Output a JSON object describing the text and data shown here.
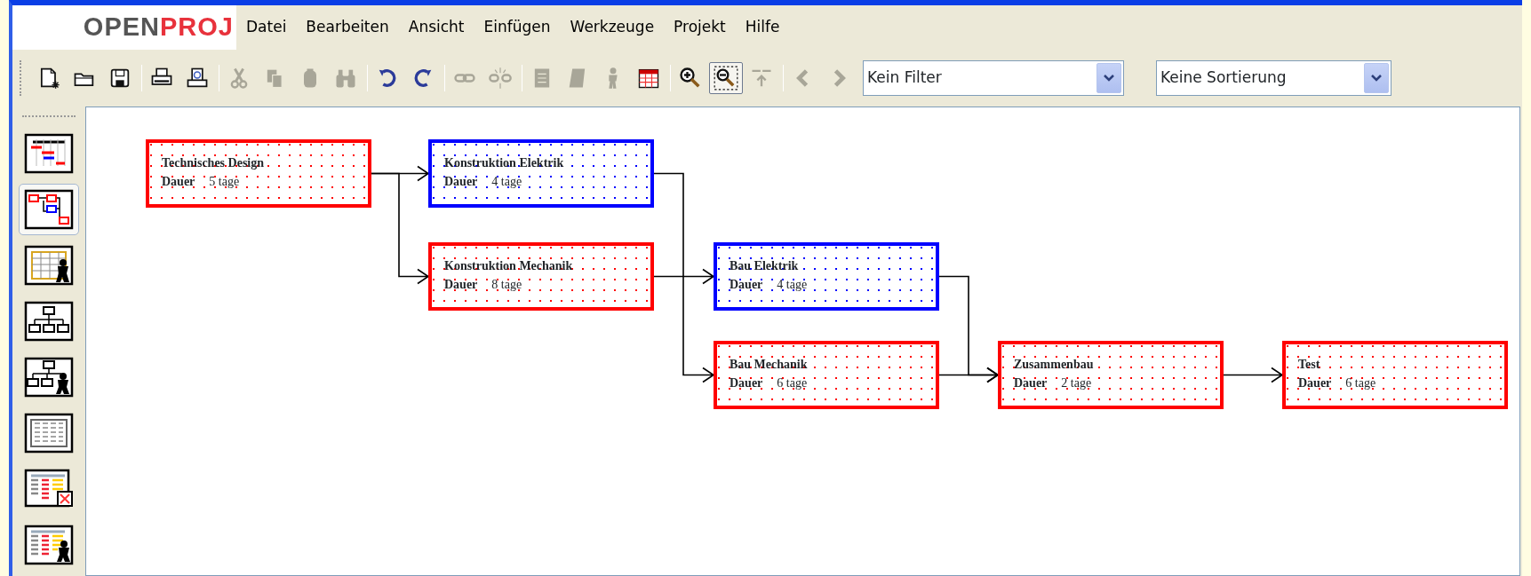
{
  "logo": {
    "text_1": "OPEN",
    "text_2": "PROJ"
  },
  "menu": [
    "Datei",
    "Bearbeiten",
    "Ansicht",
    "Einfügen",
    "Werkzeuge",
    "Projekt",
    "Hilfe"
  ],
  "toolbar": [
    {
      "disabled": false,
      "selected": false
    },
    {
      "disabled": false,
      "selected": false
    },
    {
      "disabled": false,
      "selected": false
    },
    {
      "disabled": false,
      "selected": false
    },
    {
      "disabled": false,
      "selected": false
    },
    {
      "disabled": true,
      "selected": false
    },
    {
      "disabled": true,
      "selected": false
    },
    {
      "disabled": true,
      "selected": false
    },
    {
      "disabled": true,
      "selected": false
    },
    {
      "disabled": false,
      "selected": false
    },
    {
      "disabled": false,
      "selected": false
    },
    {
      "disabled": true,
      "selected": false
    },
    {
      "disabled": true,
      "selected": false
    },
    {
      "disabled": true,
      "selected": false
    },
    {
      "disabled": true,
      "selected": false
    },
    {
      "disabled": true,
      "selected": false
    },
    {
      "disabled": false,
      "selected": false
    },
    {
      "disabled": false,
      "selected": false
    },
    {
      "disabled": false,
      "selected": true
    },
    {
      "disabled": true,
      "selected": false
    },
    {
      "disabled": true,
      "selected": false
    },
    {
      "disabled": true,
      "selected": false
    }
  ],
  "filter": {
    "value": "Kein Filter"
  },
  "sort": {
    "value": "Keine Sortierung"
  },
  "sidebar": [
    {
      "selected": false
    },
    {
      "selected": true
    },
    {
      "selected": false
    },
    {
      "selected": false
    },
    {
      "selected": false
    },
    {
      "selected": false
    },
    {
      "selected": false
    },
    {
      "selected": false
    }
  ],
  "tasks": [
    {
      "name": "Technisches Design",
      "label": "Dauer",
      "duration": "5 tage",
      "critical": true
    },
    {
      "name": "Konstruktion Elektrik",
      "label": "Dauer",
      "duration": "4 tage",
      "critical": false
    },
    {
      "name": "Konstruktion Mechanik",
      "label": "Dauer",
      "duration": "8 tage",
      "critical": true
    },
    {
      "name": "Bau Elektrik",
      "label": "Dauer",
      "duration": "4 tage",
      "critical": false
    },
    {
      "name": "Bau Mechanik",
      "label": "Dauer",
      "duration": "6 tage",
      "critical": true
    },
    {
      "name": "Zusammenbau",
      "label": "Dauer",
      "duration": "2 tage",
      "critical": true
    },
    {
      "name": "Test",
      "label": "Dauer",
      "duration": "6 tage",
      "critical": true
    }
  ]
}
